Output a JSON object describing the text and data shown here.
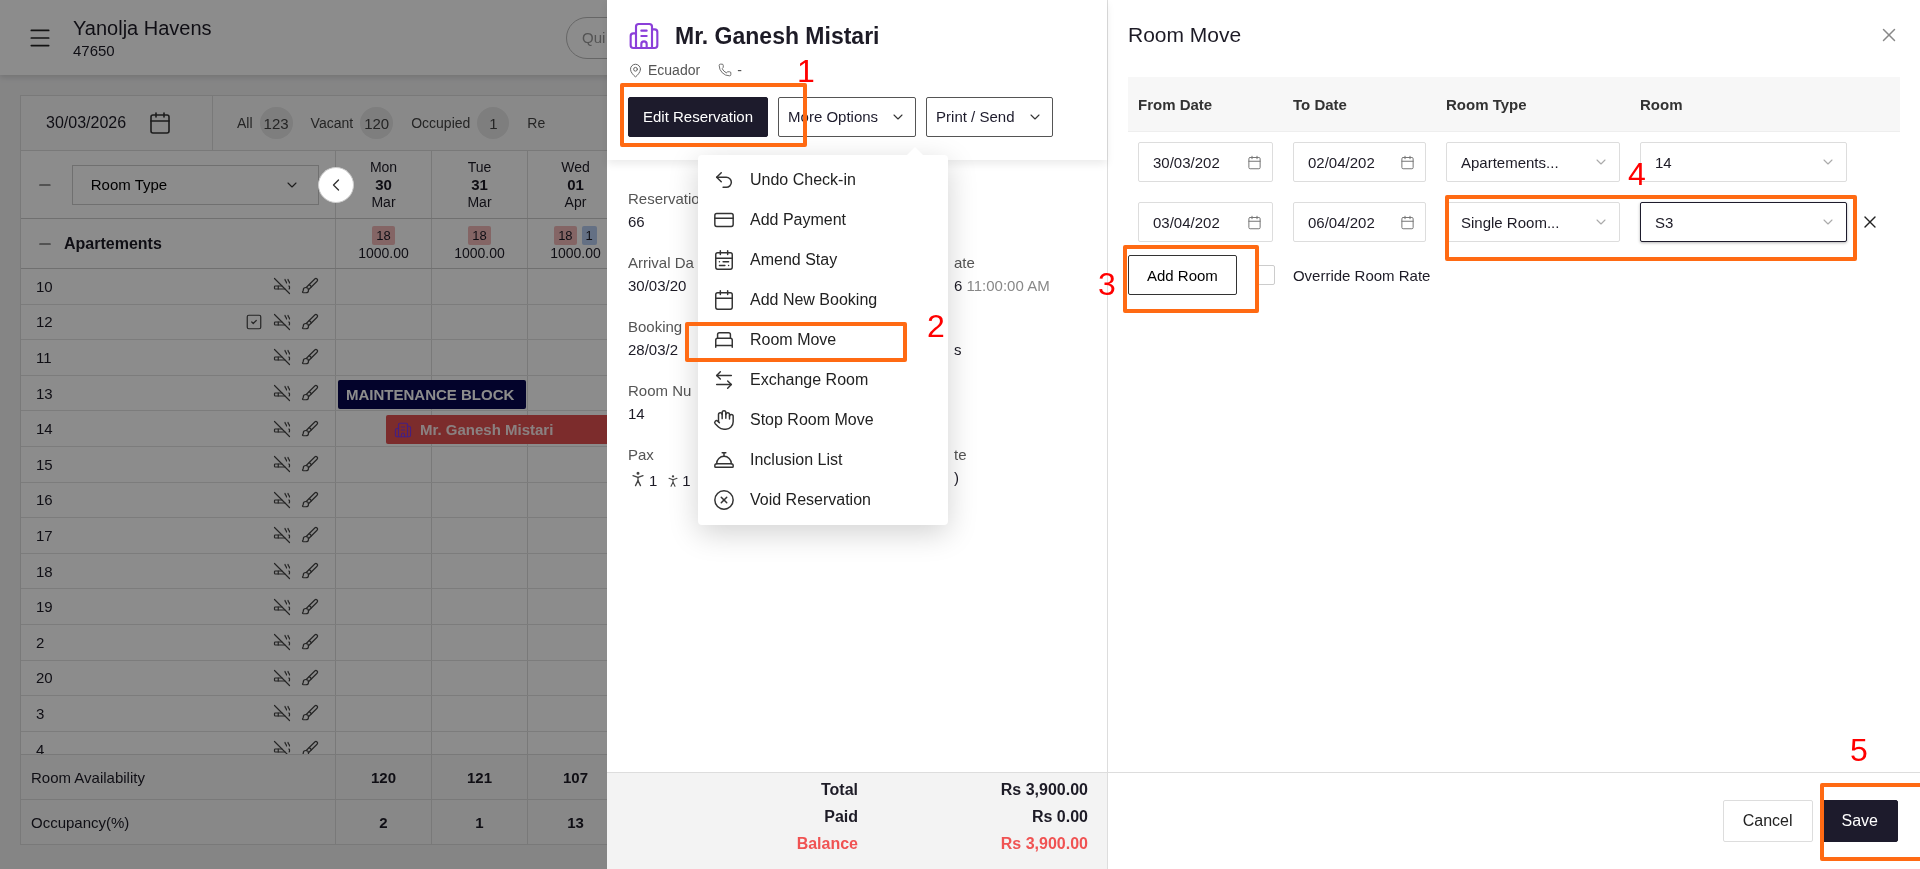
{
  "app": {
    "title": "Yanolja Havens",
    "subtitle": "47650",
    "search_placeholder": "Qui"
  },
  "grid": {
    "date": "30/03/2026",
    "filters": [
      {
        "label": "All",
        "count": "123"
      },
      {
        "label": "Vacant",
        "count": "120"
      },
      {
        "label": "Occupied",
        "count": "1"
      },
      {
        "label": "Re"
      }
    ],
    "room_type_select": "Room Type",
    "days": [
      {
        "weekday": "Mon",
        "day": "30",
        "month": "Mar"
      },
      {
        "weekday": "Tue",
        "day": "31",
        "month": "Mar"
      },
      {
        "weekday": "Wed",
        "day": "01",
        "month": "Apr"
      }
    ],
    "group": {
      "name": "Apartements",
      "expanded": true,
      "cells": [
        {
          "badges": [
            {
              "text": "18",
              "kind": "available"
            }
          ],
          "rate": "1000.00"
        },
        {
          "badges": [
            {
              "text": "18",
              "kind": "available"
            }
          ],
          "rate": "1000.00"
        },
        {
          "badges": [
            {
              "text": "18",
              "kind": "available"
            },
            {
              "text": "1",
              "kind": "booked"
            }
          ],
          "rate": "1000.00"
        }
      ]
    },
    "rooms": [
      {
        "number": "10",
        "checklist": false
      },
      {
        "number": "12",
        "checklist": true
      },
      {
        "number": "11",
        "checklist": false
      },
      {
        "number": "13",
        "checklist": false,
        "block": {
          "kind": "maintenance",
          "label": "MAINTENANCE BLOCK"
        }
      },
      {
        "number": "14",
        "checklist": false,
        "block": {
          "kind": "reservation",
          "label": "Mr. Ganesh Mistari"
        }
      },
      {
        "number": "15",
        "checklist": false
      },
      {
        "number": "16",
        "checklist": false
      },
      {
        "number": "17",
        "checklist": false
      },
      {
        "number": "18",
        "checklist": false
      },
      {
        "number": "19",
        "checklist": false
      },
      {
        "number": "2",
        "checklist": false
      },
      {
        "number": "20",
        "checklist": false
      },
      {
        "number": "3",
        "checklist": false
      },
      {
        "number": "4",
        "checklist": false
      }
    ],
    "footer": [
      {
        "label": "Room Availability",
        "values": [
          "120",
          "121",
          "107"
        ]
      },
      {
        "label": "Occupancy(%)",
        "values": [
          "2",
          "1",
          "13"
        ]
      }
    ]
  },
  "reservation": {
    "guest": {
      "name": "Mr. Ganesh Mistari",
      "country": "Ecuador",
      "phone": "-"
    },
    "actions": [
      {
        "label": "Edit Reservation",
        "kind": "primary"
      },
      {
        "label": "More Options",
        "kind": "dropdown"
      },
      {
        "label": "Print / Send",
        "kind": "dropdown"
      }
    ],
    "details": [
      {
        "label": "Reservatio",
        "value": "66"
      },
      {
        "label": "Arrival Da",
        "value": "30/03/20",
        "right_label": "ate",
        "right_value": "6",
        "right_time": "11:00:00 AM"
      },
      {
        "label": "Booking",
        "value": "28/03/2",
        "right_value": "s"
      },
      {
        "label": "Room Nu",
        "value": "14"
      },
      {
        "label": "Pax",
        "kind": "pax",
        "adults": "1",
        "children": "1",
        "right_label": "te",
        "right_value": ")"
      }
    ],
    "menu": [
      {
        "label": "Undo Check-in",
        "kind": "undo"
      },
      {
        "label": "Add Payment",
        "kind": "payment"
      },
      {
        "label": "Amend Stay",
        "kind": "amend"
      },
      {
        "label": "Add New Booking",
        "kind": "booking"
      },
      {
        "label": "Room Move",
        "kind": "move"
      },
      {
        "label": "Exchange Room",
        "kind": "exchange"
      },
      {
        "label": "Stop Room Move",
        "kind": "stop"
      },
      {
        "label": "Inclusion List",
        "kind": "inclusion"
      },
      {
        "label": "Void Reservation",
        "kind": "void"
      }
    ],
    "totals": [
      {
        "label": "Total",
        "value": "Rs 3,900.00",
        "kind": "normal"
      },
      {
        "label": "Paid",
        "value": "Rs 0.00",
        "kind": "normal"
      },
      {
        "label": "Balance",
        "value": "Rs 3,900.00",
        "kind": "due"
      }
    ]
  },
  "room_move": {
    "title": "Room Move",
    "columns": [
      "From Date",
      "To Date",
      "Room Type",
      "Room"
    ],
    "rows": [
      {
        "from": "30/03/202",
        "to": "02/04/202",
        "room_type": "Apartements...",
        "room": "14",
        "removable": false,
        "focused": false
      },
      {
        "from": "03/04/202",
        "to": "06/04/202",
        "room_type": "Single Room...",
        "room": "S3",
        "removable": true,
        "focused": true
      }
    ],
    "add_button": "Add Room",
    "override": {
      "label": "Override Room Rate",
      "checked": false
    },
    "buttons": [
      {
        "label": "Cancel",
        "kind": "secondary"
      },
      {
        "label": "Save",
        "kind": "primary"
      }
    ]
  },
  "annotations": [
    {
      "number": "1"
    },
    {
      "number": "2"
    },
    {
      "number": "3"
    },
    {
      "number": "4"
    },
    {
      "number": "5"
    }
  ]
}
